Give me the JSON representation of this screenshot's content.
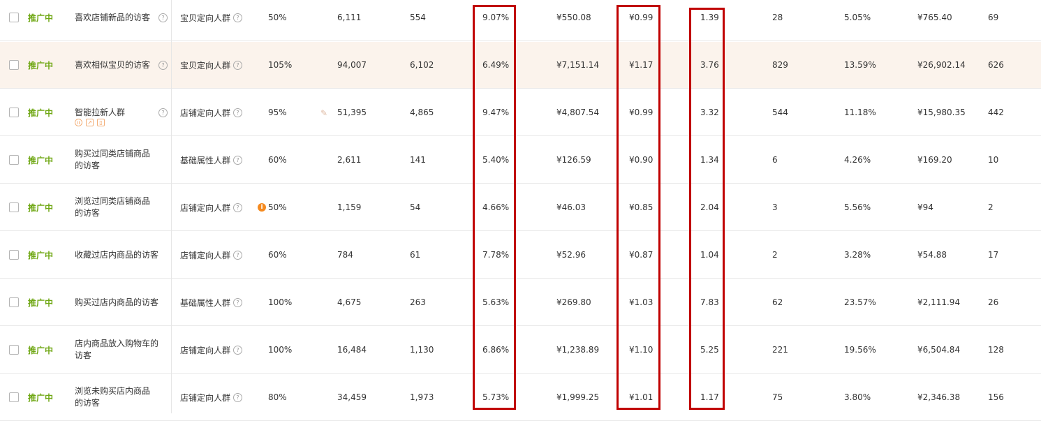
{
  "colors": {
    "status": "#6fa714",
    "highlight_row": "#fbf3ec",
    "annotation": "#c00000",
    "warning": "#f58a1f"
  },
  "icons": {
    "help": "question-circle-icon",
    "info": "info-icon",
    "edit": "pencil-icon"
  },
  "rows": [
    {
      "status": "推广中",
      "name": "喜欢店铺新品的访客",
      "type": "宝贝定向人群",
      "pct": "50%",
      "v1": "6,111",
      "v2": "554",
      "v3": "9.07%",
      "v4": "¥550.08",
      "v5": "¥0.99",
      "v6": "1.39",
      "v7": "28",
      "v8": "5.05%",
      "v9": "¥765.40",
      "v10": "69"
    },
    {
      "status": "推广中",
      "name": "喜欢相似宝贝的访客",
      "type": "宝贝定向人群",
      "pct": "105%",
      "v1": "94,007",
      "v2": "6,102",
      "v3": "6.49%",
      "v4": "¥7,151.14",
      "v5": "¥1.17",
      "v6": "3.76",
      "v7": "829",
      "v8": "13.59%",
      "v9": "¥26,902.14",
      "v10": "626"
    },
    {
      "status": "推广中",
      "name": "智能拉新人群",
      "type": "店铺定向人群",
      "pct": "95%",
      "v1": "51,395",
      "v2": "4,865",
      "v3": "9.47%",
      "v4": "¥4,807.54",
      "v5": "¥0.99",
      "v6": "3.32",
      "v7": "544",
      "v8": "11.18%",
      "v9": "¥15,980.35",
      "v10": "442"
    },
    {
      "status": "推广中",
      "name": "购买过同类店铺商品的访客",
      "type": "基础属性人群",
      "pct": "60%",
      "v1": "2,611",
      "v2": "141",
      "v3": "5.40%",
      "v4": "¥126.59",
      "v5": "¥0.90",
      "v6": "1.34",
      "v7": "6",
      "v8": "4.26%",
      "v9": "¥169.20",
      "v10": "10"
    },
    {
      "status": "推广中",
      "name": "浏览过同类店铺商品的访客",
      "type": "店铺定向人群",
      "pct": "50%",
      "v1": "1,159",
      "v2": "54",
      "v3": "4.66%",
      "v4": "¥46.03",
      "v5": "¥0.85",
      "v6": "2.04",
      "v7": "3",
      "v8": "5.56%",
      "v9": "¥94",
      "v10": "2"
    },
    {
      "status": "推广中",
      "name": "收藏过店内商品的访客",
      "type": "店铺定向人群",
      "pct": "60%",
      "v1": "784",
      "v2": "61",
      "v3": "7.78%",
      "v4": "¥52.96",
      "v5": "¥0.87",
      "v6": "1.04",
      "v7": "2",
      "v8": "3.28%",
      "v9": "¥54.88",
      "v10": "17"
    },
    {
      "status": "推广中",
      "name": "购买过店内商品的访客",
      "type": "基础属性人群",
      "pct": "100%",
      "v1": "4,675",
      "v2": "263",
      "v3": "5.63%",
      "v4": "¥269.80",
      "v5": "¥1.03",
      "v6": "7.83",
      "v7": "62",
      "v8": "23.57%",
      "v9": "¥2,111.94",
      "v10": "26"
    },
    {
      "status": "推广中",
      "name": "店内商品放入购物车的访客",
      "type": "店铺定向人群",
      "pct": "100%",
      "v1": "16,484",
      "v2": "1,130",
      "v3": "6.86%",
      "v4": "¥1,238.89",
      "v5": "¥1.10",
      "v6": "5.25",
      "v7": "221",
      "v8": "19.56%",
      "v9": "¥6,504.84",
      "v10": "128"
    },
    {
      "status": "推广中",
      "name": "浏览未购买店内商品的访客",
      "type": "店铺定向人群",
      "pct": "80%",
      "v1": "34,459",
      "v2": "1,973",
      "v3": "5.73%",
      "v4": "¥1,999.25",
      "v5": "¥1.01",
      "v6": "1.17",
      "v7": "75",
      "v8": "3.80%",
      "v9": "¥2,346.38",
      "v10": "156"
    }
  ]
}
